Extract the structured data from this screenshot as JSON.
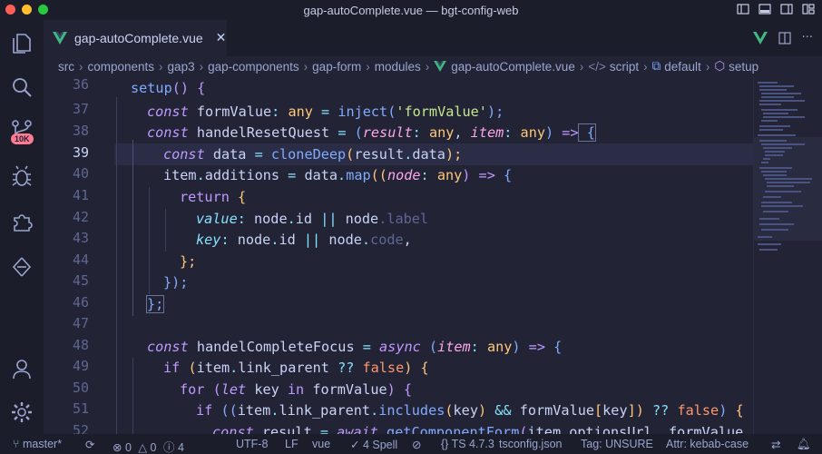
{
  "window": {
    "title": "gap-autoComplete.vue — bgt-config-web"
  },
  "activity": {
    "badge": "10K"
  },
  "tab": {
    "label": "gap-autoComplete.vue",
    "close": "✕"
  },
  "tab_actions": {
    "more": "···"
  },
  "breadcrumb": [
    "src",
    "components",
    "gap3",
    "gap-components",
    "gap-form",
    "modules",
    "gap-autoComplete.vue",
    "script",
    "default",
    "setup"
  ],
  "line_numbers": [
    "36",
    "37",
    "38",
    "39",
    "40",
    "41",
    "42",
    "43",
    "44",
    "45",
    "46",
    "47",
    "48",
    "49",
    "50",
    "51",
    "52"
  ],
  "current_line": "39",
  "code": {
    "l36": [
      "setup",
      "()",
      " ",
      "{"
    ],
    "l37": [
      "const",
      " formValue",
      ":",
      " any",
      " =",
      " inject",
      "(",
      "'formValue'",
      ");"
    ],
    "l38": [
      "const",
      " handelResetQuest",
      " =",
      " (",
      "result",
      ":",
      " any",
      ", ",
      "item",
      ":",
      " any",
      ")",
      " =>",
      " {"
    ],
    "l39": [
      "const",
      " data",
      " =",
      " cloneDeep",
      "(",
      "result",
      ".",
      "data",
      ");"
    ],
    "l40": [
      "item",
      ".",
      "additions",
      " =",
      " data",
      ".",
      "map",
      "((",
      "node",
      ":",
      " any",
      ")",
      " =>",
      " {"
    ],
    "l41": [
      "return",
      " {"
    ],
    "l42": [
      "value",
      ":",
      " node",
      ".",
      "id",
      " ||",
      " node",
      ".",
      "label"
    ],
    "l43": [
      "key",
      ":",
      " node",
      ".",
      "id",
      " ||",
      " node",
      ".",
      "code",
      ","
    ],
    "l44": [
      "};"
    ],
    "l45": [
      "});"
    ],
    "l46": [
      "};"
    ],
    "l48": [
      "const",
      " handelCompleteFocus",
      " =",
      " async",
      " (",
      "item",
      ":",
      " any",
      ")",
      " =>",
      " {"
    ],
    "l49": [
      "if",
      " (",
      "item",
      ".",
      "link_parent",
      " ??",
      " false",
      ")",
      " {"
    ],
    "l50": [
      "for",
      " (",
      "let",
      " key",
      " in",
      " formValue",
      ")",
      " {"
    ],
    "l51": [
      "if",
      " ((",
      "item",
      ".",
      "link_parent",
      ".",
      "includes",
      "(",
      "key",
      ")",
      " &&",
      " formValue",
      "[",
      "key",
      "])",
      " ??",
      " false",
      ")",
      " {"
    ],
    "l52": [
      "const",
      " result",
      " =",
      " await",
      " getComponentForm",
      "(",
      "item",
      ".",
      "optionsUrl",
      ", ",
      "formValue"
    ]
  },
  "status": {
    "branch": "master*",
    "errors": "0",
    "warnings": "0",
    "info": "4",
    "encoding": "UTF-8",
    "eol": "LF",
    "language": "vue",
    "spell": "4 Spell",
    "ts": "TS 4.7.3",
    "tsconfig": "tsconfig.json",
    "tag": "Tag: UNSURE",
    "attr": "Attr: kebab-case"
  }
}
